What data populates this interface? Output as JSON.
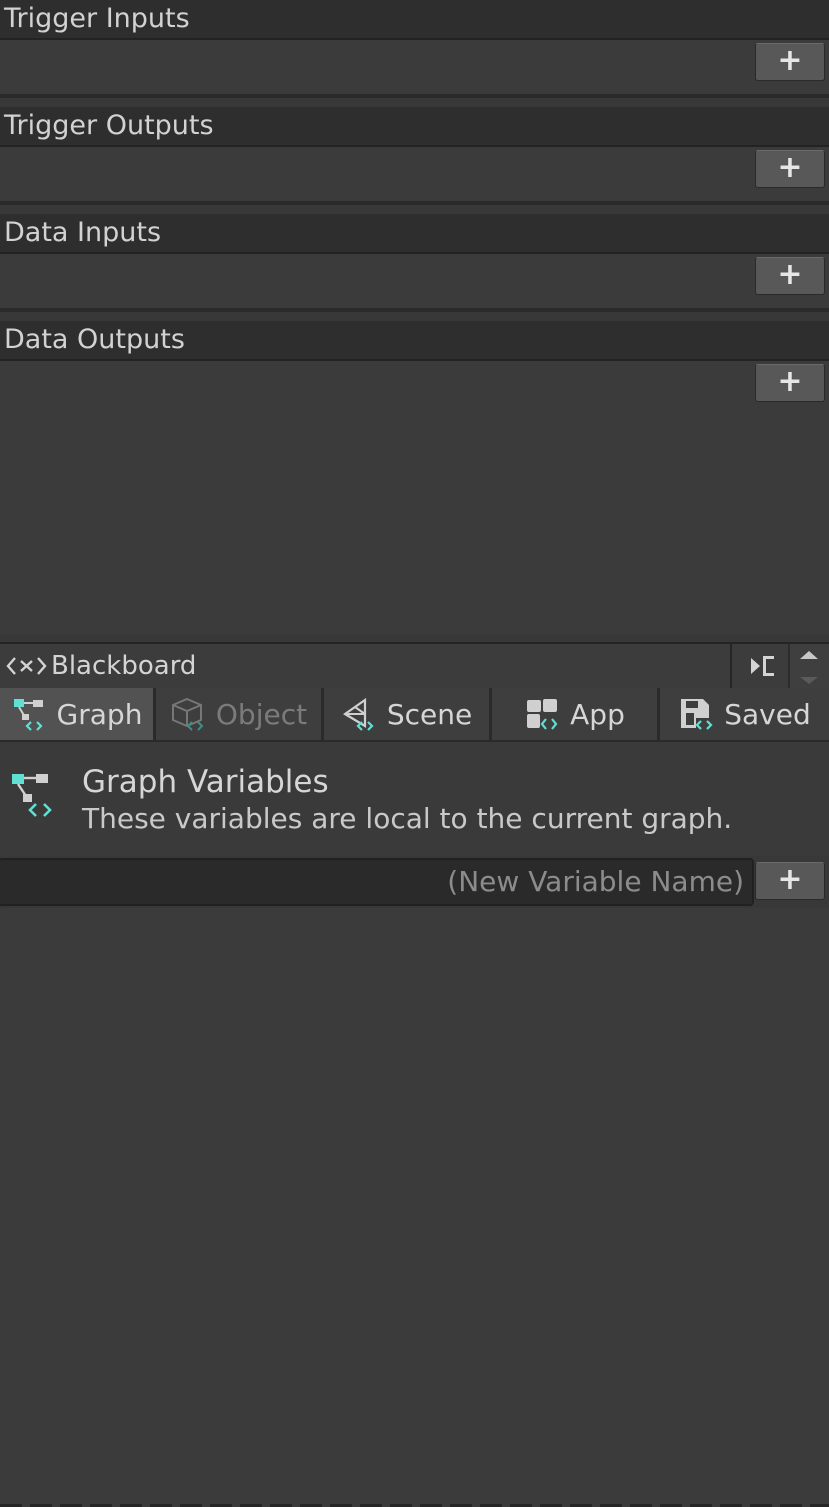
{
  "sections": [
    {
      "title": "Trigger Inputs",
      "add_label": "+"
    },
    {
      "title": "Trigger Outputs",
      "add_label": "+"
    },
    {
      "title": "Data Inputs",
      "add_label": "+"
    },
    {
      "title": "Data Outputs",
      "add_label": "+"
    }
  ],
  "blackboard": {
    "title": "Blackboard",
    "tabs": [
      {
        "label": "Graph",
        "icon": "graph-icon",
        "state": "active"
      },
      {
        "label": "Object",
        "icon": "object-icon",
        "state": "disabled"
      },
      {
        "label": "Scene",
        "icon": "scene-icon",
        "state": "normal"
      },
      {
        "label": "App",
        "icon": "app-icon",
        "state": "normal"
      },
      {
        "label": "Saved",
        "icon": "saved-icon",
        "state": "normal"
      }
    ],
    "variables_title": "Graph Variables",
    "variables_description": "These variables are local to the current graph.",
    "new_variable_placeholder": "(New Variable Name)",
    "add_variable_label": "+"
  },
  "colors": {
    "accent": "#5fe0d2",
    "panel_bg": "#383838",
    "header_bg": "#2e2e2e",
    "button_bg": "#585858"
  }
}
